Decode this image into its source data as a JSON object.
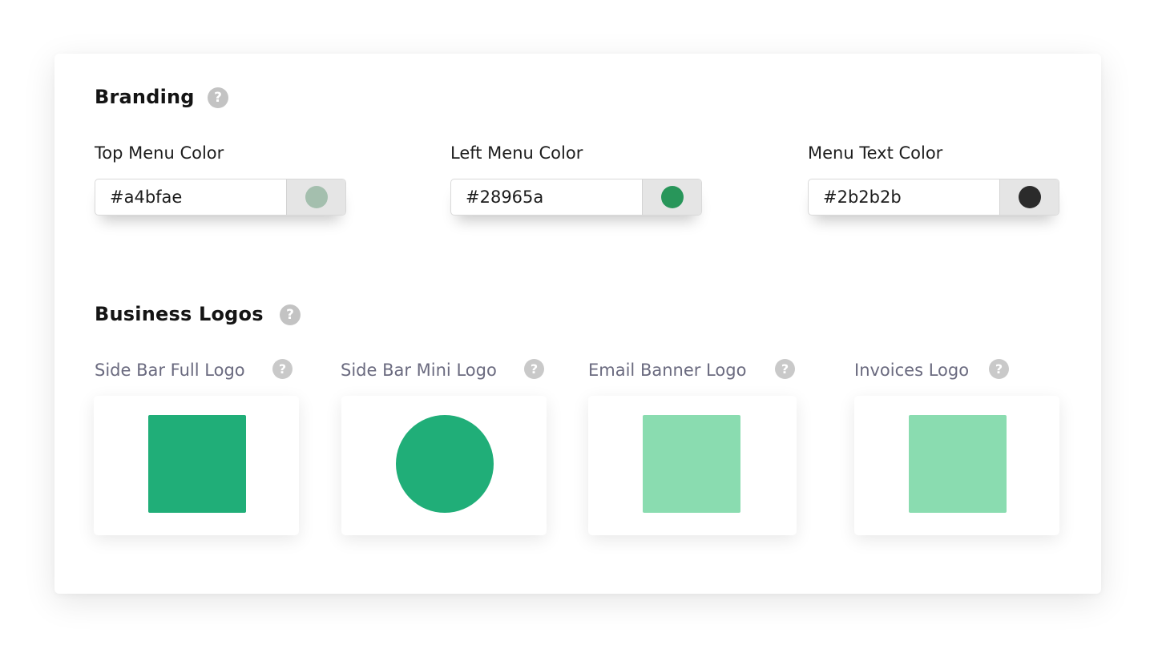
{
  "branding": {
    "title": "Branding",
    "help_icon": "?",
    "fields": [
      {
        "label": "Top Menu Color",
        "value": "#a4bfae",
        "swatch": "#a4bfae"
      },
      {
        "label": "Left Menu Color",
        "value": "#28965a",
        "swatch": "#28965a"
      },
      {
        "label": "Menu Text Color",
        "value": "#2b2b2b",
        "swatch": "#2b2b2b"
      }
    ]
  },
  "business_logos": {
    "title": "Business Logos",
    "help_icon": "?",
    "logos": [
      {
        "label": "Side Bar Full Logo",
        "help_icon": "?",
        "shape": "square",
        "color": "#20ae78"
      },
      {
        "label": "Side Bar Mini Logo",
        "help_icon": "?",
        "shape": "circle",
        "color": "#20ae78"
      },
      {
        "label": "Email Banner Logo",
        "help_icon": "?",
        "shape": "square",
        "color": "#8adcb0"
      },
      {
        "label": "Invoices Logo",
        "help_icon": "?",
        "shape": "square",
        "color": "#8adcb0"
      }
    ]
  }
}
